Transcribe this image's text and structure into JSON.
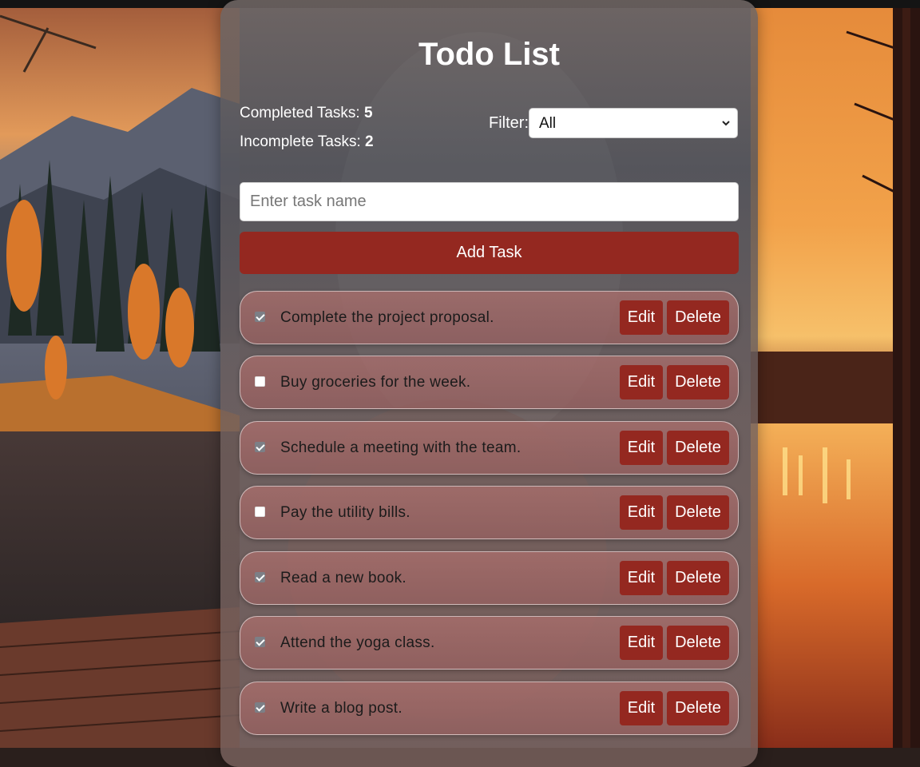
{
  "app": {
    "title": "Todo List"
  },
  "stats": {
    "completed_label": "Completed Tasks: ",
    "completed_count": "5",
    "incomplete_label": "Incomplete Tasks: ",
    "incomplete_count": "2"
  },
  "filter": {
    "label": "Filter:",
    "selected": "All"
  },
  "input": {
    "placeholder": "Enter task name",
    "value": ""
  },
  "add_button": {
    "label": "Add Task"
  },
  "tasks": [
    {
      "text": "Complete the project proposal.",
      "completed": true,
      "edit_label": "Edit",
      "delete_label": "Delete"
    },
    {
      "text": "Buy groceries for the week.",
      "completed": false,
      "edit_label": "Edit",
      "delete_label": "Delete"
    },
    {
      "text": "Schedule a meeting with the team.",
      "completed": true,
      "edit_label": "Edit",
      "delete_label": "Delete"
    },
    {
      "text": "Pay the utility bills.",
      "completed": false,
      "edit_label": "Edit",
      "delete_label": "Delete"
    },
    {
      "text": "Read a new book.",
      "completed": true,
      "edit_label": "Edit",
      "delete_label": "Delete"
    },
    {
      "text": "Attend the yoga class.",
      "completed": true,
      "edit_label": "Edit",
      "delete_label": "Delete"
    },
    {
      "text": "Write a blog post.",
      "completed": true,
      "edit_label": "Edit",
      "delete_label": "Delete"
    }
  ],
  "colors": {
    "accent": "#942820",
    "panel": "#6f6462",
    "text_light": "#ffffff",
    "text_dark": "#1b1b1b"
  }
}
